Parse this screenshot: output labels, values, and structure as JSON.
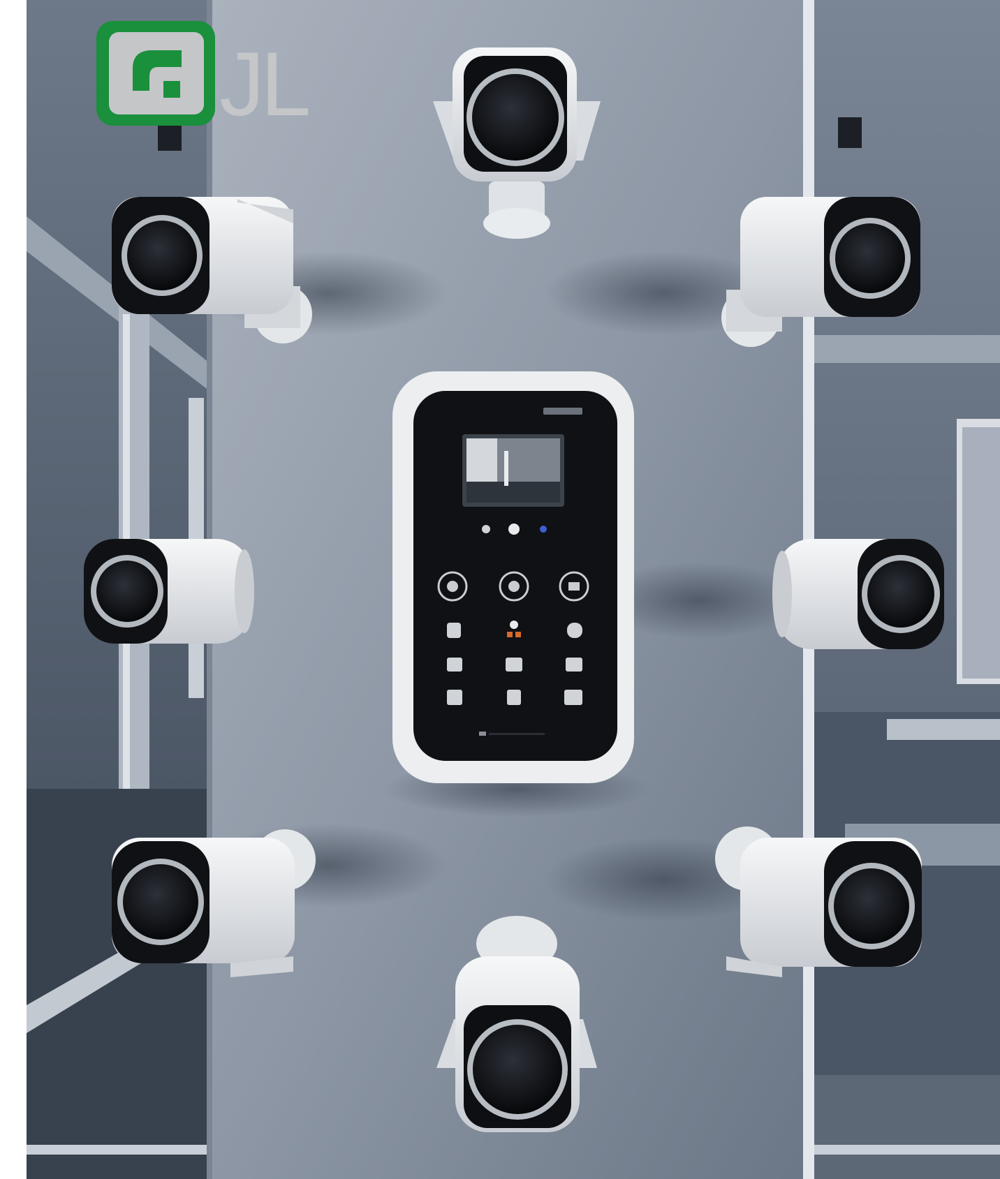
{
  "logo": {
    "text": "JL",
    "brand_color": "#1a8f3c",
    "secondary_color": "#c4c6c8",
    "icon": "phone-handset-icon"
  },
  "scene": {
    "subject": "security-cameras-around-wall-keypad",
    "camera_count": 8,
    "keypad": {
      "brand_label": "",
      "screen_content": "camera-feed-thumbnail",
      "round_buttons": 3,
      "icon_rows": 3,
      "icons_per_row": 3
    },
    "colors": {
      "wall": "#8d97a5",
      "wall_dark": "#4f5b6b",
      "room": "#5e6a7b",
      "camera_body": "#e8eaed",
      "lens": "#121418",
      "keypad_face": "#0f1114",
      "keypad_frame": "#eceef0"
    }
  }
}
